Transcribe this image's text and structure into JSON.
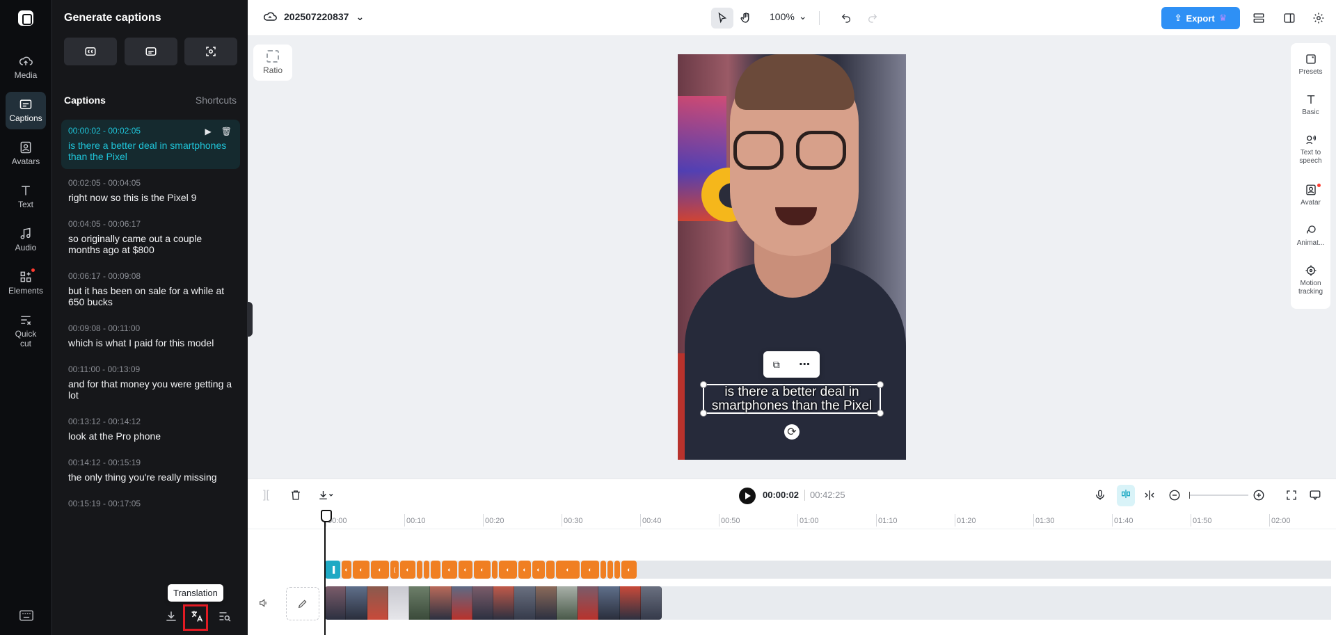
{
  "nav": {
    "items": [
      {
        "label": "Media",
        "icon": "cloud-upload-icon"
      },
      {
        "label": "Captions",
        "icon": "captions-icon"
      },
      {
        "label": "Avatars",
        "icon": "avatar-icon"
      },
      {
        "label": "Text",
        "icon": "text-icon"
      },
      {
        "label": "Audio",
        "icon": "music-note-icon"
      },
      {
        "label": "Elements",
        "icon": "elements-icon"
      },
      {
        "label": "Quick cut",
        "icon": "quick-cut-icon"
      }
    ],
    "active": "Captions"
  },
  "panel": {
    "title": "Generate captions",
    "captions_title": "Captions",
    "shortcuts_label": "Shortcuts",
    "captions": [
      {
        "time": "00:00:02 - 00:02:05",
        "text": "is there a better deal in smartphones than the Pixel"
      },
      {
        "time": "00:02:05 - 00:04:05",
        "text": "right now so this is the Pixel 9"
      },
      {
        "time": "00:04:05 - 00:06:17",
        "text": "so originally came out a couple months ago at $800"
      },
      {
        "time": "00:06:17 - 00:09:08",
        "text": "but it has been on sale for a while at 650 bucks"
      },
      {
        "time": "00:09:08 - 00:11:00",
        "text": "which is what I paid for this model"
      },
      {
        "time": "00:11:00 - 00:13:09",
        "text": "and for that money you were getting a lot"
      },
      {
        "time": "00:13:12 - 00:14:12",
        "text": "look at the Pro phone"
      },
      {
        "time": "00:14:12 - 00:15:19",
        "text": "the only thing you're really missing"
      },
      {
        "time": "00:15:19 - 00:17:05",
        "text": ""
      }
    ],
    "tooltip": "Translation"
  },
  "topbar": {
    "project_name": "202507220837",
    "zoom": "100%",
    "export_label": "Export"
  },
  "canvas": {
    "ratio_label": "Ratio",
    "caption_text": "is there a better deal in smartphones than the Pixel"
  },
  "inspector": {
    "items": [
      {
        "label": "Presets",
        "icon": "presets-icon"
      },
      {
        "label": "Basic",
        "icon": "text-t-icon"
      },
      {
        "label": "Text to speech",
        "icon": "tts-icon"
      },
      {
        "label": "Avatar",
        "icon": "avatar-icon"
      },
      {
        "label": "Animat...",
        "icon": "animation-icon"
      },
      {
        "label": "Motion tracking",
        "icon": "motion-tracking-icon"
      }
    ]
  },
  "timeline": {
    "current_time": "00:00:02",
    "duration": "00:42:25",
    "ruler": [
      "00:00",
      "00:10",
      "00:20",
      "00:30",
      "00:40",
      "00:50",
      "01:00",
      "01:10",
      "01:20",
      "01:30",
      "01:40",
      "01:50",
      "02:00"
    ]
  },
  "colors": {
    "accent": "#1fc4d8",
    "export": "#2e90f5",
    "caption_clip": "#f07f22",
    "highlight": "#e21b23"
  }
}
